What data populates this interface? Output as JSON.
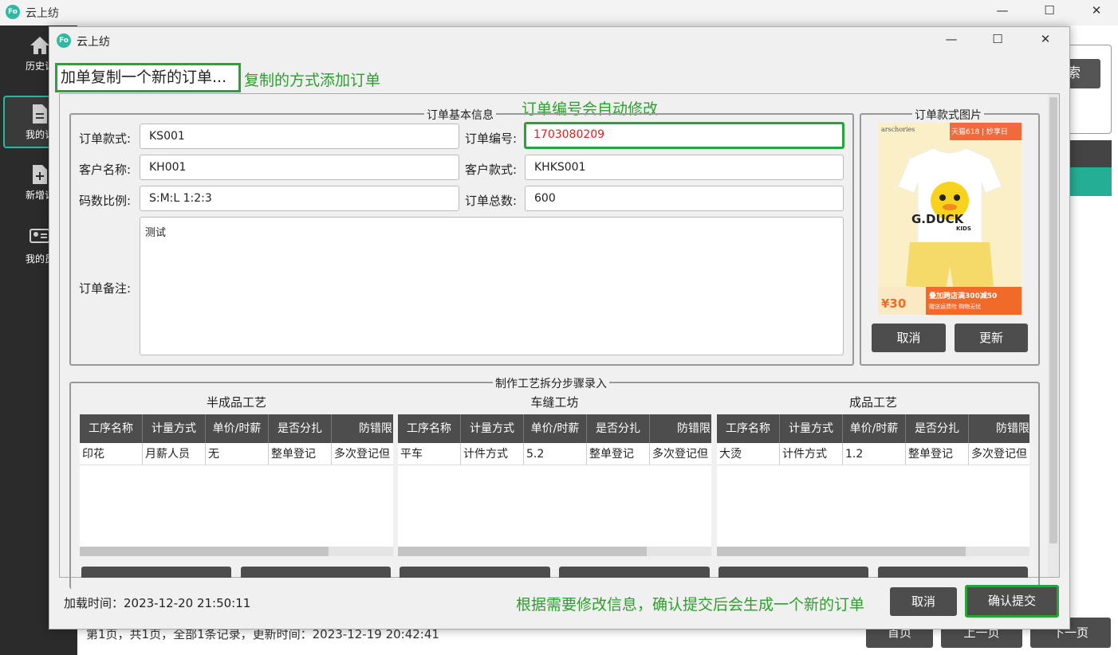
{
  "app_title": "云上纺",
  "logo_text": "Fo",
  "window_controls": {
    "minimize": "—",
    "maximize": "☐",
    "close": "✕"
  },
  "sidebar": {
    "items": [
      {
        "label": "历史记",
        "icon": "home-icon"
      },
      {
        "label": "我的订",
        "icon": "document-icon"
      },
      {
        "label": "新增订",
        "icon": "add-document-icon"
      },
      {
        "label": "我的员",
        "icon": "employee-card-icon"
      }
    ]
  },
  "background": {
    "search_button": "索",
    "footer_text": "第1页，共1页，全部1条记录，更新时间：2023-12-19 20:42:41",
    "pagination": {
      "first": "首页",
      "prev": "上一页",
      "next": "下一页"
    }
  },
  "dialog": {
    "title": "云上纺",
    "copy_label": "加单复制一个新的订单...",
    "note_copy": "复制的方式添加订单",
    "note_order_no": "订单编号会自动修改",
    "note_submit": "根据需要修改信息，确认提交后会生成一个新的订单",
    "basic_info": {
      "title": "订单基本信息",
      "style_label": "订单款式:",
      "style_value": "KS001",
      "order_no_label": "订单编号:",
      "order_no_value": "1703080209",
      "customer_label": "客户名称:",
      "customer_value": "KH001",
      "customer_style_label": "客户款式:",
      "customer_style_value": "KHKS001",
      "size_ratio_label": "码数比例:",
      "size_ratio_value": "S:M:L 1:2:3",
      "total_label": "订单总数:",
      "total_value": "600",
      "remark_label": "订单备注:",
      "remark_value": "测试"
    },
    "image_panel": {
      "title": "订单款式图片",
      "cancel": "取消",
      "update": "更新",
      "brand_text": "arschories",
      "promo_top": "天猫618 | 妙享日",
      "product_text": "G.DUCK",
      "product_sub": "KIDS",
      "promo_bottom1": "叠加跨店满300减50",
      "promo_bottom2": "赠送运费险 购物无忧",
      "price": "¥30"
    },
    "process": {
      "title": "制作工艺拆分步骤录入",
      "headers": [
        "工序名称",
        "计量方式",
        "单价/时薪",
        "是否分扎",
        "防错限"
      ],
      "tables": [
        {
          "title": "半成品工艺",
          "rows": [
            [
              "印花",
              "月薪人员",
              "无",
              "整单登记",
              "多次登记但"
            ]
          ]
        },
        {
          "title": "车缝工坊",
          "rows": [
            [
              "平车",
              "计件方式",
              "5.2",
              "整单登记",
              "多次登记但"
            ]
          ]
        },
        {
          "title": "成品工艺",
          "rows": [
            [
              "大烫",
              "计件方式",
              "1.2",
              "整单登记",
              "多次登记但"
            ]
          ]
        }
      ]
    },
    "load_time": "加载时间：2023-12-20 21:50:11",
    "cancel_button": "取消",
    "confirm_button": "确认提交"
  },
  "colors": {
    "accent": "#28b89d",
    "highlight_border": "#28a33a",
    "order_no_text": "#e02020",
    "dark_button": "#4d4d4d"
  }
}
